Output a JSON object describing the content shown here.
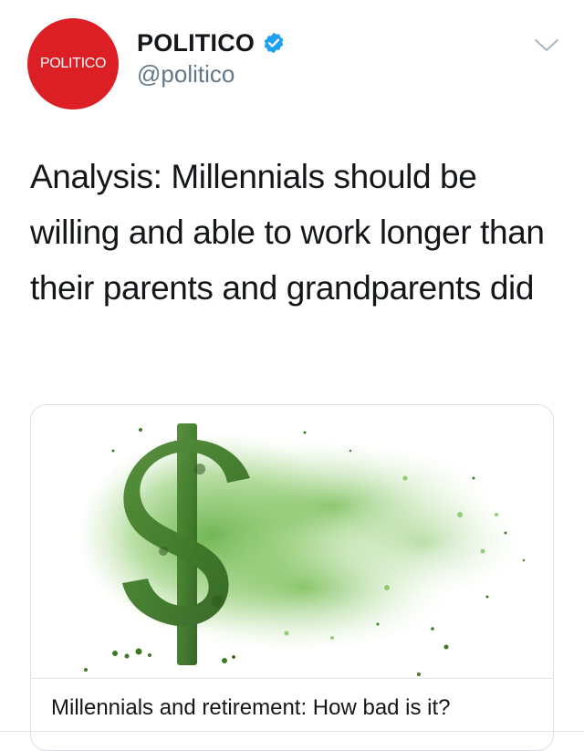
{
  "account": {
    "avatar_text": "POLITICO",
    "display_name": "POLITICO",
    "handle": "@politico",
    "verified_icon": "verified-badge-icon",
    "avatar_color": "#dc1e25",
    "verified_color": "#1da1f2"
  },
  "menu": {
    "icon": "chevron-down-icon"
  },
  "tweet": {
    "text": "Analysis: Millennials should be willing and able to work longer than their parents and grandparents did"
  },
  "card": {
    "image_description_icon": "dollar-sign-dissolving-image",
    "title": "Millennials and retirement: How bad is it?",
    "accent_color": "#5fae3c"
  }
}
